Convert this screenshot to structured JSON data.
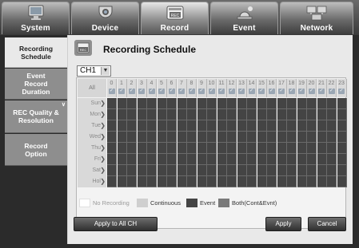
{
  "top_nav": {
    "tabs": [
      {
        "label": "System",
        "icon": "monitor-icon",
        "active": false
      },
      {
        "label": "Device",
        "icon": "camera-icon",
        "active": false
      },
      {
        "label": "Record",
        "icon": "rec-icon",
        "active": true
      },
      {
        "label": "Event",
        "icon": "alarm-icon",
        "active": false
      },
      {
        "label": "Network",
        "icon": "network-icon",
        "active": false
      }
    ]
  },
  "sidebar": {
    "items": [
      {
        "label": "Recording Schedule",
        "active": true
      },
      {
        "label": "Event Record Duration",
        "active": false
      },
      {
        "label": "REC Quality & Resolution",
        "active": false
      },
      {
        "label": "Record Option",
        "active": false
      }
    ]
  },
  "main": {
    "title": "Recording Schedule",
    "title_icon": "rec-icon",
    "channel": {
      "selected": "CH1"
    }
  },
  "schedule": {
    "all_label": "All",
    "hours": [
      "0",
      "1",
      "2",
      "3",
      "4",
      "5",
      "6",
      "7",
      "8",
      "9",
      "10",
      "11",
      "12",
      "13",
      "14",
      "15",
      "16",
      "17",
      "18",
      "19",
      "20",
      "21",
      "22",
      "23"
    ],
    "days": [
      "Sun",
      "Mon",
      "Tue",
      "Wed",
      "Thu",
      "Fri",
      "Sat",
      "Hol"
    ],
    "cell_mode": "Event"
  },
  "legend": {
    "items": [
      {
        "label": "No Recording",
        "color": "#ffffff"
      },
      {
        "label": "Continuous",
        "color": "#cfcfcf"
      },
      {
        "label": "Event",
        "color": "#444444"
      },
      {
        "label": "Both(Cont&Evnt)",
        "color": "#7a7a7a"
      }
    ]
  },
  "buttons": {
    "apply_all": "Apply to All CH",
    "apply": "Apply",
    "cancel": "Cancel"
  }
}
